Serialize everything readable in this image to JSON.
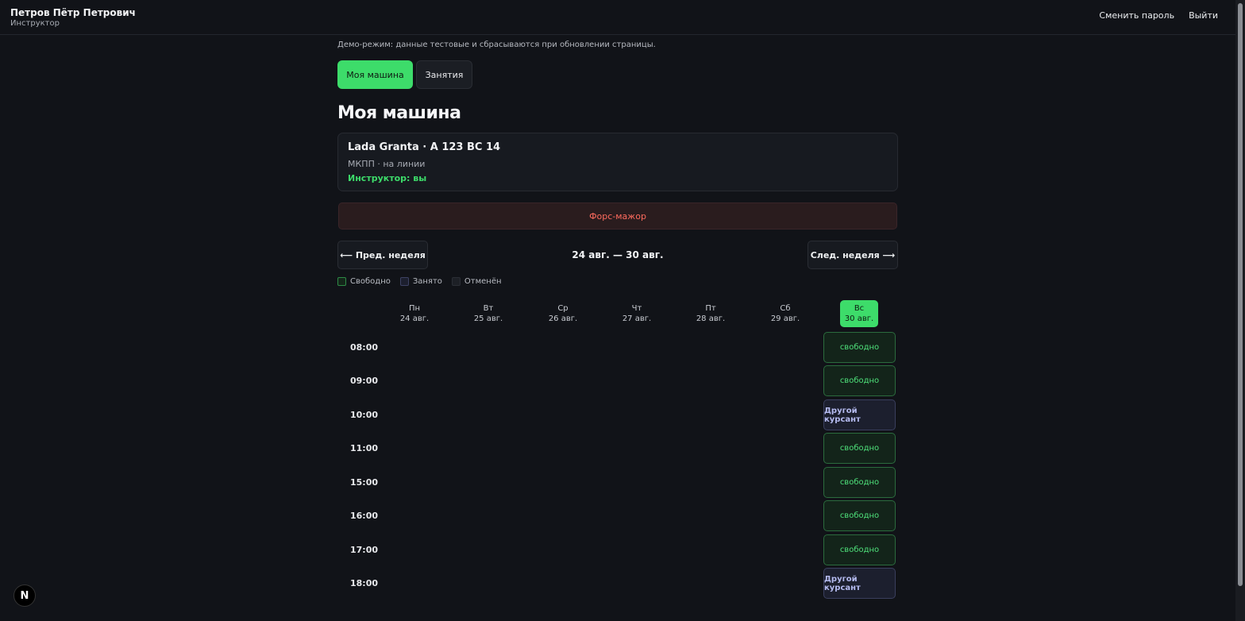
{
  "header": {
    "user_name": "Петров Пётр Петрович",
    "user_role": "Инструктор",
    "change_password": "Сменить пароль",
    "logout": "Выйти"
  },
  "demo_note": "Демо-режим: данные тестовые и сбрасываются при обновлении страницы.",
  "tabs": [
    {
      "label": "Моя машина",
      "active": true
    },
    {
      "label": "Занятия",
      "active": false
    }
  ],
  "page_title": "Моя машина",
  "car": {
    "name": "Lada Granta · А 123 ВС 14",
    "meta": "МКПП · на линии",
    "instructor": "Инструктор: вы"
  },
  "force_majeure": "Форс-мажор",
  "week_nav": {
    "prev": "⟵ Пред. неделя",
    "range": "24 авг. — 30 авг.",
    "next": "След. неделя ⟶"
  },
  "legend": [
    {
      "label": "Свободно",
      "kind": "free"
    },
    {
      "label": "Занято",
      "kind": "busy"
    },
    {
      "label": "Отменён",
      "kind": "cancel"
    }
  ],
  "days": [
    {
      "dow": "Пн",
      "date": "24 авг.",
      "today": false
    },
    {
      "dow": "Вт",
      "date": "25 авг.",
      "today": false
    },
    {
      "dow": "Ср",
      "date": "26 авг.",
      "today": false
    },
    {
      "dow": "Чт",
      "date": "27 авг.",
      "today": false
    },
    {
      "dow": "Пт",
      "date": "28 авг.",
      "today": false
    },
    {
      "dow": "Сб",
      "date": "29 авг.",
      "today": false
    },
    {
      "dow": "Вс",
      "date": "30 авг.",
      "today": true
    }
  ],
  "slots": [
    {
      "time": "08:00",
      "label": "свободно",
      "kind": "free"
    },
    {
      "time": "09:00",
      "label": "свободно",
      "kind": "free"
    },
    {
      "time": "10:00",
      "label": "Другой курсант",
      "kind": "busy"
    },
    {
      "time": "11:00",
      "label": "свободно",
      "kind": "free"
    },
    {
      "time": "15:00",
      "label": "свободно",
      "kind": "free"
    },
    {
      "time": "16:00",
      "label": "свободно",
      "kind": "free"
    },
    {
      "time": "17:00",
      "label": "свободно",
      "kind": "free"
    },
    {
      "time": "18:00",
      "label": "Другой курсант",
      "kind": "busy"
    }
  ],
  "badge": "N"
}
